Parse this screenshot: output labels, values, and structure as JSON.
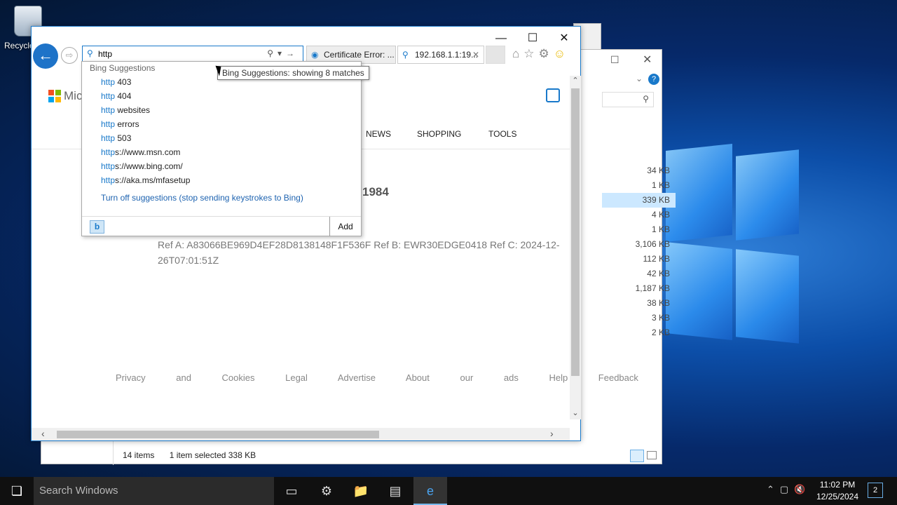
{
  "desktop": {
    "recycle_label": "Recycle"
  },
  "explorer": {
    "sizes": [
      "34 KB",
      "1 KB",
      "339 KB",
      "4 KB",
      "1 KB",
      "3,106 KB",
      "112 KB",
      "42 KB",
      "1,187 KB",
      "38 KB",
      "3 KB",
      "2 KB"
    ],
    "selected_index": 2,
    "status_items": "14 items",
    "status_selected": "1 item selected  338 KB"
  },
  "ie": {
    "window_controls": {
      "minimize": "—",
      "maximize": "☐",
      "close": "✕"
    },
    "address_value": "http",
    "tabs": [
      {
        "label": "Certificate Error: ...",
        "icon": "ie-icon"
      },
      {
        "label": "192.168.1.1:19...",
        "icon": "search-icon",
        "close": "✕"
      }
    ],
    "page": {
      "brand": "Mic",
      "nav": [
        "NEWS",
        "SHOPPING",
        "TOOLS"
      ],
      "heading": "1984",
      "ref_text": "Ref A: A83066BE969D4EF28D8138148F1F536F Ref B: EWR30EDGE0418 Ref C: 2024-12-26T07:01:51Z",
      "footer": "Privacy and Cookies   Legal   Advertise   About our ads   Help   Feedback"
    }
  },
  "dropdown": {
    "header": "Bing Suggestions",
    "tooltip": "Bing Suggestions: showing 8 matches",
    "suggestions": [
      {
        "hl": "http",
        "rest": " 403"
      },
      {
        "hl": "http",
        "rest": " 404"
      },
      {
        "hl": "http",
        "rest": " websites"
      },
      {
        "hl": "http",
        "rest": " errors"
      },
      {
        "hl": "http",
        "rest": " 503"
      },
      {
        "hl": "http",
        "rest": "s://www.msn.com"
      },
      {
        "hl": "http",
        "rest": "s://www.bing.com/"
      },
      {
        "hl": "http",
        "rest": "s://aka.ms/mfasetup"
      }
    ],
    "turn_off": "Turn off suggestions (stop sending keystrokes to Bing)",
    "add": "Add",
    "bing_glyph": "b"
  },
  "taskbar": {
    "search_placeholder": "Search Windows",
    "time": "11:02 PM",
    "date": "12/25/2024",
    "notification_count": "2"
  }
}
